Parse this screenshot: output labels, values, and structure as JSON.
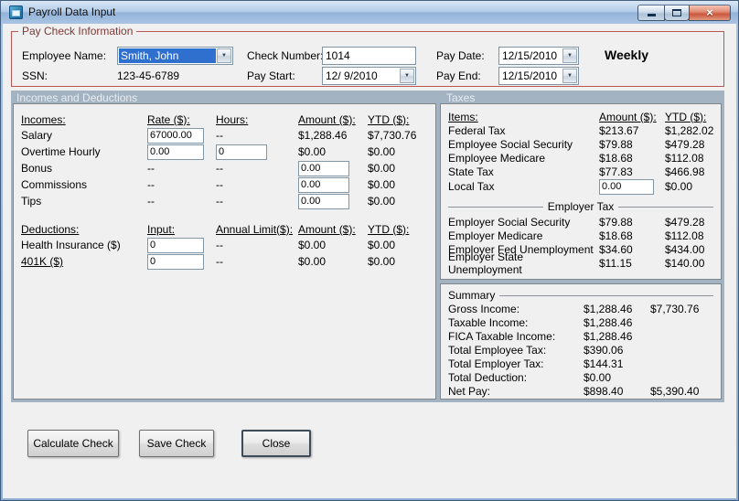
{
  "colors": {
    "titlebar_blue": "#a9c3e2",
    "groupbox_border_red": "#bc5653",
    "groupbox_label_red": "#7b3b38",
    "section_band_bg": "#a4b3c2",
    "selection_blue": "#2f6fce",
    "close_button_red": "#cc563c",
    "client_gray": "#f0f0f0"
  },
  "icons": {
    "close": "×",
    "dropdown": "▼"
  },
  "window": {
    "title": "Payroll Data Input"
  },
  "paycheck": {
    "group_label": "Pay Check Information",
    "employee_name_label": "Employee Name:",
    "employee_name_value": "Smith, John",
    "ssn_label": "SSN:",
    "ssn_value": "123-45-6789",
    "check_number_label": "Check Number:",
    "check_number_value": "1014",
    "pay_start_label": "Pay Start:",
    "pay_start_value": "12/ 9/2010",
    "pay_date_label": "Pay Date:",
    "pay_date_value": "12/15/2010",
    "pay_end_label": "Pay End:",
    "pay_end_value": "12/15/2010",
    "frequency": "Weekly"
  },
  "sections": {
    "left": "Incomes and Deductions",
    "right": "Taxes"
  },
  "incomes": {
    "headers": {
      "name": "Incomes:",
      "rate": "Rate ($):",
      "hours": "Hours:",
      "amount": "Amount ($):",
      "ytd": "YTD ($):"
    },
    "salary": {
      "label": "Salary",
      "rate": "67000.00",
      "hours": "--",
      "amount": "$1,288.46",
      "ytd": "$7,730.76"
    },
    "overtime": {
      "label": "Overtime Hourly",
      "rate": "0.00",
      "hours": "0",
      "amount": "$0.00",
      "ytd": "$0.00"
    },
    "bonus": {
      "label": "Bonus",
      "rate": "--",
      "hours": "--",
      "amount": "0.00",
      "ytd": "$0.00"
    },
    "commissions": {
      "label": "Commissions",
      "rate": "--",
      "hours": "--",
      "amount": "0.00",
      "ytd": "$0.00"
    },
    "tips": {
      "label": "Tips",
      "rate": "--",
      "hours": "--",
      "amount": "0.00",
      "ytd": "$0.00"
    }
  },
  "deductions": {
    "headers": {
      "name": "Deductions:",
      "input": "Input:",
      "limit": "Annual Limit($):",
      "amount": "Amount ($):",
      "ytd": "YTD ($):"
    },
    "health": {
      "label": "Health Insurance  ($)",
      "input": "0",
      "limit": "--",
      "amount": "$0.00",
      "ytd": "$0.00"
    },
    "k401": {
      "label": "401K  ($)",
      "input": "0",
      "limit": "--",
      "amount": "$0.00",
      "ytd": "$0.00"
    }
  },
  "taxes": {
    "headers": {
      "items": "Items:",
      "amount": "Amount ($):",
      "ytd": "YTD ($):"
    },
    "rows": [
      {
        "label": "Federal Tax",
        "amount": "$213.67",
        "ytd": "$1,282.02"
      },
      {
        "label": "Employee Social Security",
        "amount": "$79.88",
        "ytd": "$479.28"
      },
      {
        "label": "Employee Medicare",
        "amount": "$18.68",
        "ytd": "$112.08"
      },
      {
        "label": "State Tax",
        "amount": "$77.83",
        "ytd": "$466.98"
      }
    ],
    "local_tax": {
      "label": "Local Tax",
      "amount": "0.00",
      "ytd": "$0.00"
    },
    "employer_separator": "Employer Tax",
    "employer_rows": [
      {
        "label": "Employer Social Security",
        "amount": "$79.88",
        "ytd": "$479.28"
      },
      {
        "label": "Employer Medicare",
        "amount": "$18.68",
        "ytd": "$112.08"
      },
      {
        "label": "Employer Fed Unemployment",
        "amount": "$34.60",
        "ytd": "$434.00"
      },
      {
        "label": "Employer State Unemployment",
        "amount": "$11.15",
        "ytd": "$140.00"
      }
    ]
  },
  "summary": {
    "header": "Summary",
    "rows": [
      {
        "label": "Gross Income:",
        "amount": "$1,288.46",
        "ytd": "$7,730.76"
      },
      {
        "label": "Taxable Income:",
        "amount": "$1,288.46",
        "ytd": ""
      },
      {
        "label": "FICA Taxable Income:",
        "amount": "$1,288.46",
        "ytd": ""
      },
      {
        "label": "Total Employee Tax:",
        "amount": "$390.06",
        "ytd": ""
      },
      {
        "label": "Total Employer Tax:",
        "amount": "$144.31",
        "ytd": ""
      },
      {
        "label": "Total Deduction:",
        "amount": "$0.00",
        "ytd": ""
      },
      {
        "label": "Net Pay:",
        "amount": "$898.40",
        "ytd": "$5,390.40"
      }
    ]
  },
  "buttons": {
    "calculate": "Calculate Check",
    "save": "Save Check",
    "close": "Close"
  }
}
